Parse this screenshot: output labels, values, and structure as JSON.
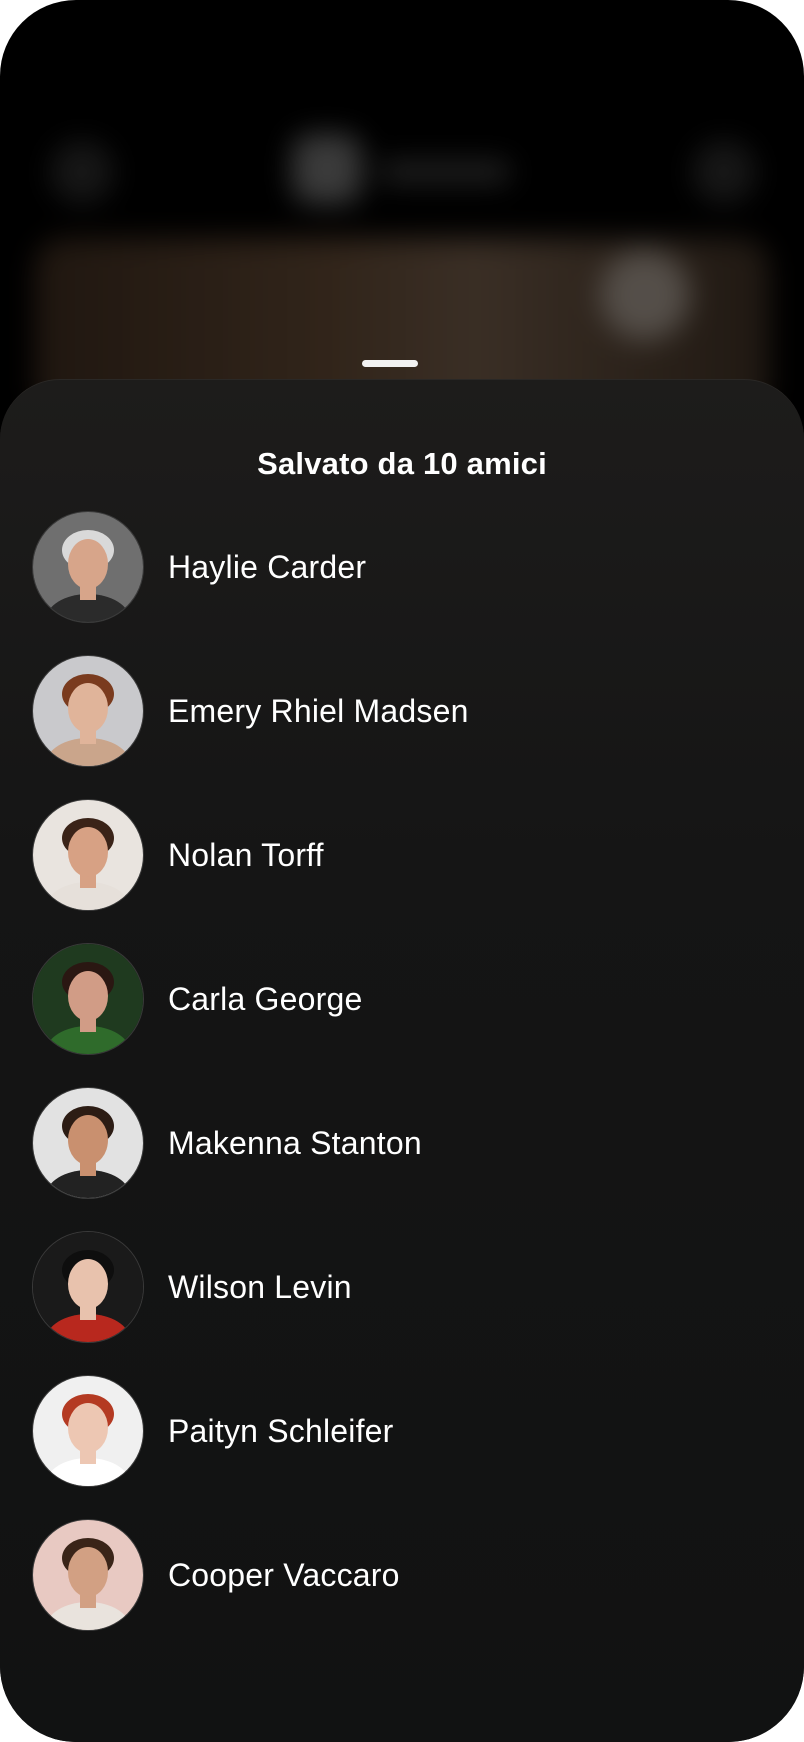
{
  "sheet": {
    "title": "Salvato da 10 amici"
  },
  "friends": [
    {
      "name": "Haylie Carder",
      "avatar": {
        "bg": "#6f6f6f",
        "skin": "#d7a58a",
        "hair": "#d9d9d9",
        "shirt": "#2b2b2b"
      }
    },
    {
      "name": "Emery Rhiel Madsen",
      "avatar": {
        "bg": "#c9c9cc",
        "skin": "#e0b49a",
        "hair": "#7a3b1e",
        "shirt": "#caa58b"
      }
    },
    {
      "name": "Nolan Torff",
      "avatar": {
        "bg": "#e9e4df",
        "skin": "#d7a184",
        "hair": "#3a2318",
        "shirt": "#e6e0da"
      }
    },
    {
      "name": "Carla George",
      "avatar": {
        "bg": "#1f3a1f",
        "skin": "#d19c86",
        "hair": "#2a1712",
        "shirt": "#2f6b2b"
      }
    },
    {
      "name": "Makenna Stanton",
      "avatar": {
        "bg": "#e2e2e2",
        "skin": "#c9906f",
        "hair": "#2c1c14",
        "shirt": "#222222"
      }
    },
    {
      "name": "Wilson Levin",
      "avatar": {
        "bg": "#1a1a1a",
        "skin": "#e8c2ad",
        "hair": "#0e0e0e",
        "shirt": "#b8281e"
      }
    },
    {
      "name": "Paityn Schleifer",
      "avatar": {
        "bg": "#f0f0f0",
        "skin": "#edc7b3",
        "hair": "#b43a22",
        "shirt": "#ffffff"
      }
    },
    {
      "name": "Cooper Vaccaro",
      "avatar": {
        "bg": "#e8c9c2",
        "skin": "#d2a083",
        "hair": "#3a2418",
        "shirt": "#e9e3dd"
      }
    }
  ]
}
